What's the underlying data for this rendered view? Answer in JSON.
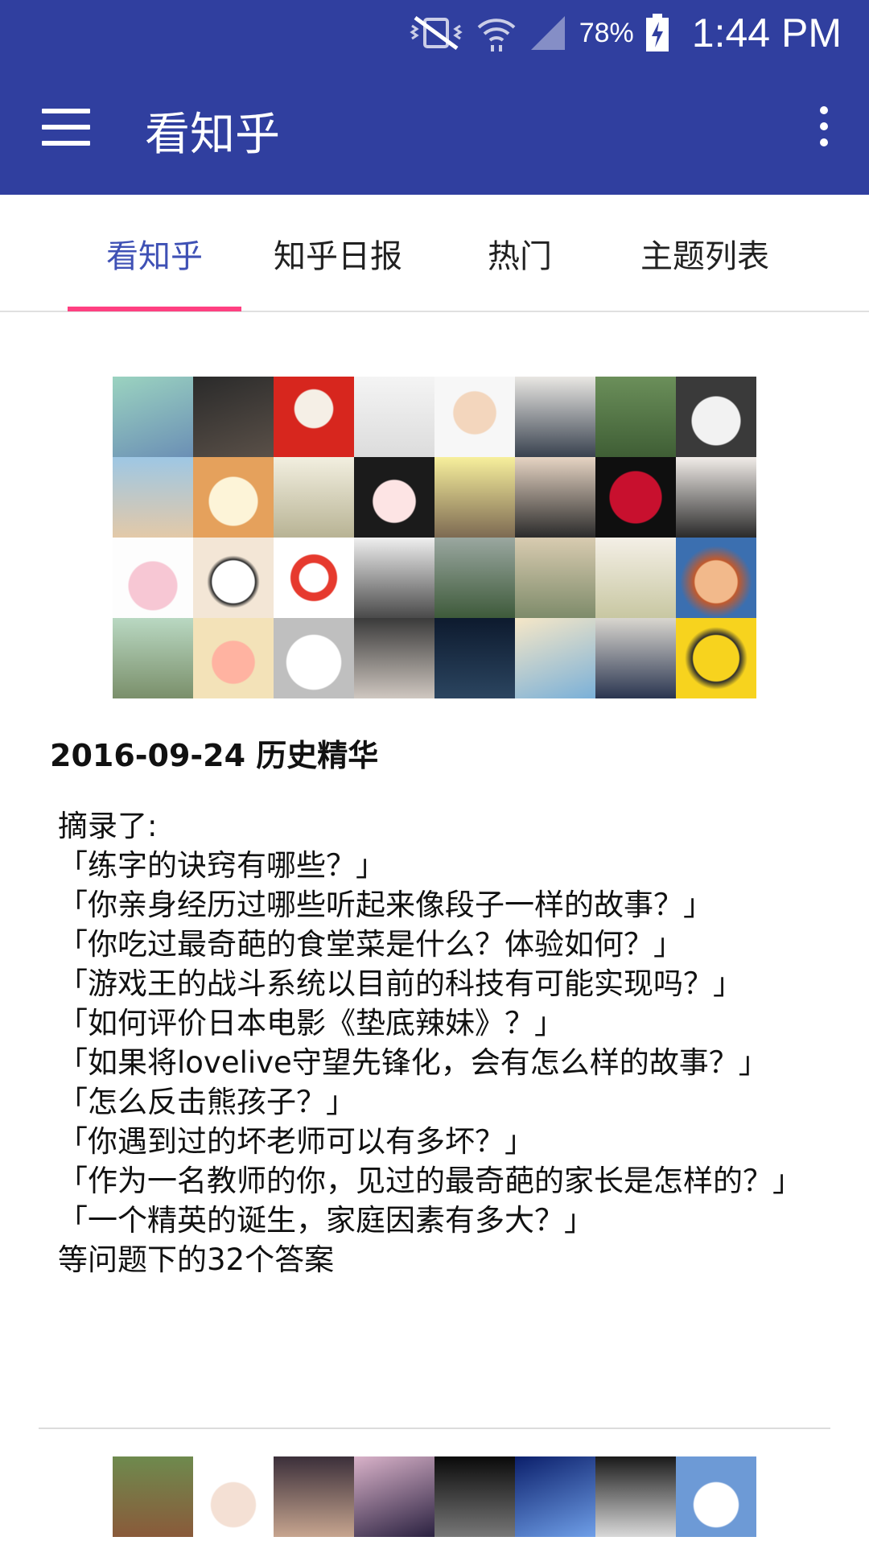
{
  "status_bar": {
    "battery": "78%",
    "time": "1:44 PM"
  },
  "app_bar": {
    "title": "看知乎"
  },
  "tabs": [
    {
      "label": "看知乎",
      "active": true
    },
    {
      "label": "知乎日报",
      "active": false
    },
    {
      "label": "热门",
      "active": false
    },
    {
      "label": "主题列表",
      "active": false
    }
  ],
  "post": {
    "title": "2016-09-24 历史精华",
    "intro": "摘录了:",
    "questions": [
      "「练字的诀窍有哪些？」",
      "「你亲身经历过哪些听起来像段子一样的故事？」",
      "「你吃过最奇葩的食堂菜是什么？体验如何？」",
      "「游戏王的战斗系统以目前的科技有可能实现吗？」",
      "「如何评价日本电影《垫底辣妹》？」",
      "「如果将lovelive守望先锋化，会有怎么样的故事？」",
      "「怎么反击熊孩子？」",
      "「你遇到过的坏老师可以有多坏？」",
      "「作为一名教师的你，见过的最奇葩的家长是怎样的？」",
      "「一个精英的诞生，家庭因素有多大？」"
    ],
    "summary": "等问题下的32个答案"
  },
  "colors": {
    "primary": "#303f9f",
    "accent": "#ff4081",
    "tab_active": "#3f51b5"
  }
}
